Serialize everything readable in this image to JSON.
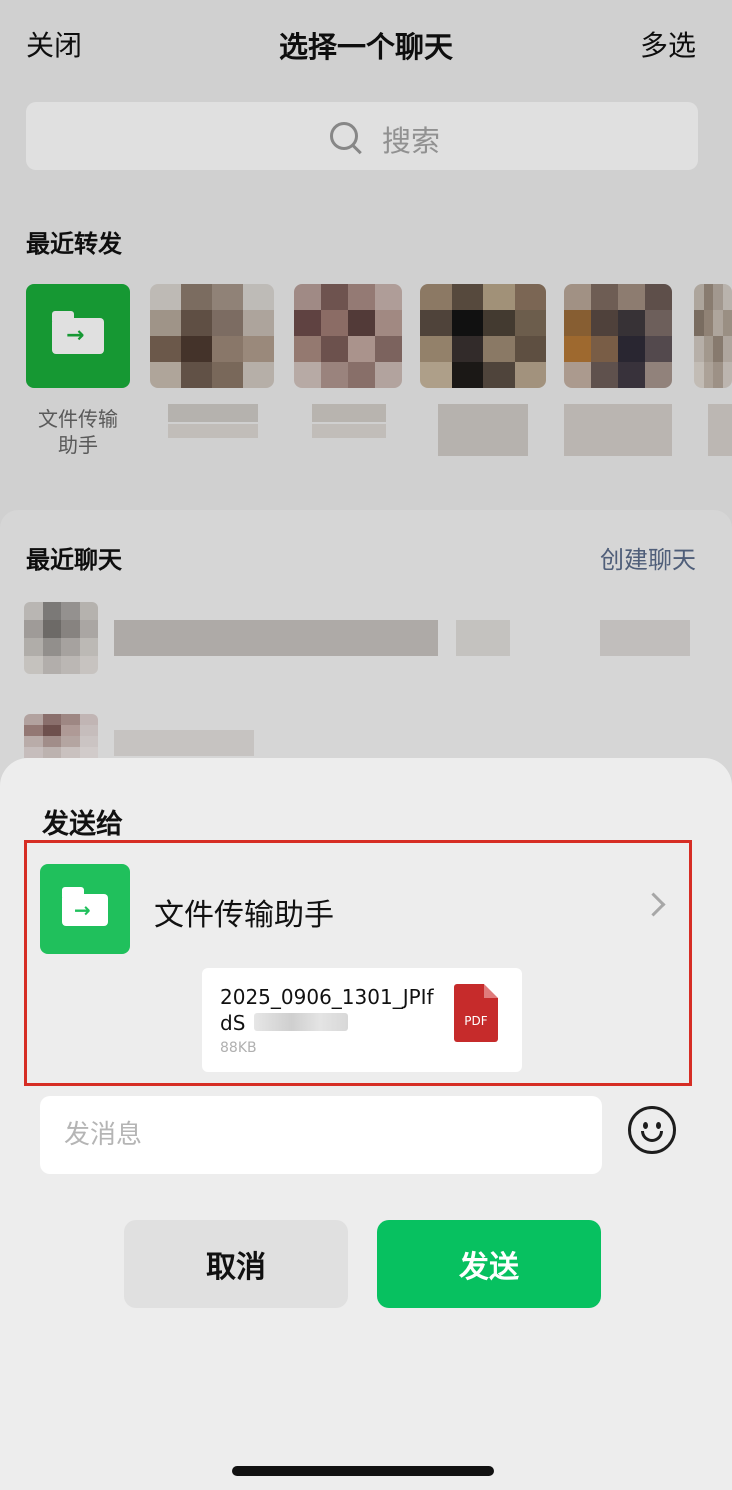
{
  "header": {
    "close_label": "关闭",
    "title": "选择一个聊天",
    "multi_select_label": "多选"
  },
  "search": {
    "placeholder": "搜索"
  },
  "recent_forward": {
    "title": "最近转发",
    "items": [
      {
        "label": "文件传输\n助手",
        "icon": "folder-icon"
      }
    ]
  },
  "recent_chats": {
    "title": "最近聊天",
    "create_label": "创建聊天"
  },
  "send_sheet": {
    "title": "发送给",
    "recipient": {
      "name": "文件传输助手",
      "icon": "folder-icon"
    },
    "file": {
      "name": "2025_0906_1301_JPIfdS",
      "size": "88KB",
      "type_label": "PDF"
    },
    "message_placeholder": "发消息",
    "cancel_label": "取消",
    "send_label": "发送"
  },
  "colors": {
    "wechat_green": "#07c160",
    "highlight_red": "#d62d24"
  }
}
